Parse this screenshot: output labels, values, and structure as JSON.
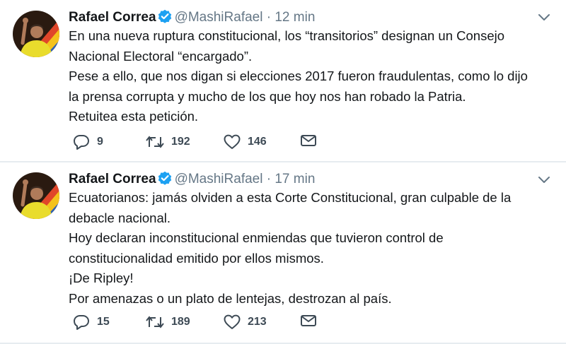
{
  "tweets": [
    {
      "name": "Rafael Correa",
      "handle": "@MashiRafael",
      "separator": "·",
      "time": "12 min",
      "lines": [
        "En una nueva ruptura constitucional, los “transitorios” designan un Consejo",
        "Nacional Electoral “encargado”.",
        "Pese a ello, que nos digan si elecciones 2017 fueron fraudulentas, como lo dijo",
        "la prensa corrupta y mucho de los que hoy nos han robado la Patria.",
        "Retuitea esta petición."
      ],
      "replies": "9",
      "retweets": "192",
      "likes": "146"
    },
    {
      "name": "Rafael Correa",
      "handle": "@MashiRafael",
      "separator": "·",
      "time": "17 min",
      "lines": [
        "Ecuatorianos: jamás olviden a esta Corte Constitucional, gran culpable de la",
        "debacle nacional.",
        "Hoy declaran inconstitucional enmiendas que tuvieron control de",
        "constitucionalidad emitido por ellos mismos.",
        "¡De Ripley!",
        "Por amenazas o un plato de lentejas, destrozan al país."
      ],
      "replies": "15",
      "retweets": "189",
      "likes": "213"
    }
  ],
  "icons": {
    "verified": "verified-badge-icon",
    "caret": "chevron-down-icon",
    "reply": "reply-icon",
    "retweet": "retweet-icon",
    "like": "heart-icon",
    "dm": "envelope-icon"
  },
  "colors": {
    "text": "#14171a",
    "secondary": "#657786",
    "verified": "#1da1f2",
    "divider": "#e6ecf0"
  }
}
